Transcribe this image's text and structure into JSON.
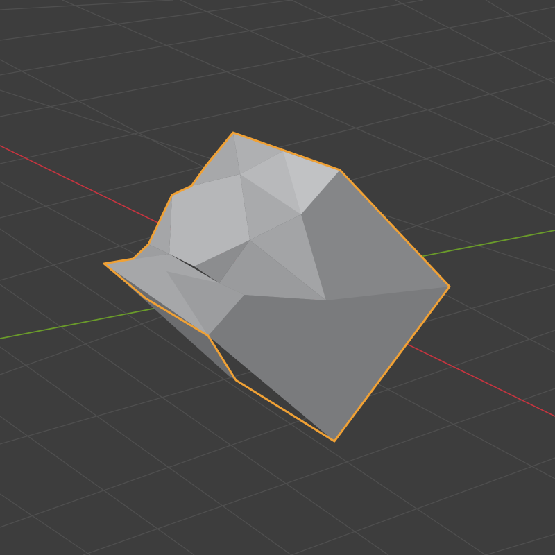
{
  "viewport": {
    "view": "perspective",
    "background_color": "#3d3d3d",
    "grid": {
      "visible": true,
      "line_color": "#4e4e4e"
    },
    "axes": {
      "x_axis_color": "#c8343f",
      "y_axis_color": "#6a9b2a"
    }
  },
  "object": {
    "shape": "low-poly rock",
    "selected": true,
    "active": true,
    "shading": "solid",
    "base_color": "#a0a2a5",
    "selection_outline_color": "#f0a135"
  }
}
